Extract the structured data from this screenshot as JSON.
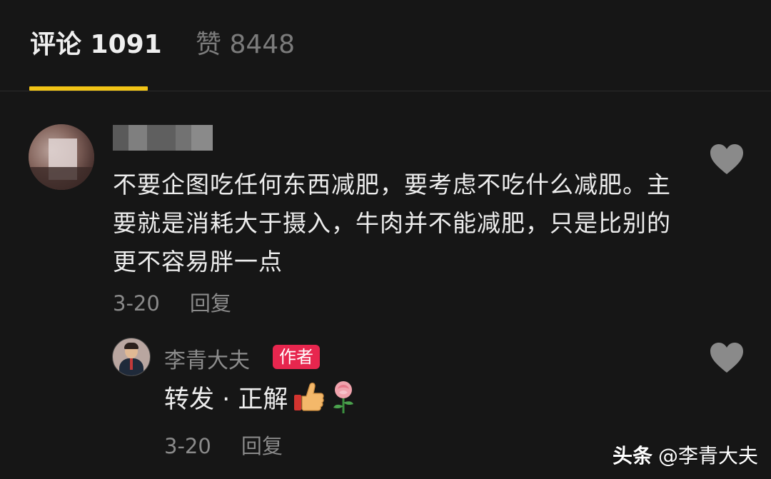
{
  "tabs": {
    "comments": "评论 1091",
    "likes": "赞 8448"
  },
  "comments": [
    {
      "text": "不要企图吃任何东西减肥，要考虑不吃什么减肥。主要就是消耗大于摄入，牛肉并不能减肥，只是比别的更不容易胖一点",
      "date": "3-20",
      "reply_label": "回复",
      "replies": [
        {
          "author": "李青大夫",
          "badge": "作者",
          "text": "转发 · 正解",
          "emojis": [
            "thumbs-up",
            "rose"
          ],
          "date": "3-20",
          "reply_label": "回复"
        }
      ]
    }
  ],
  "watermark": {
    "brand": "头条",
    "handle": "@李青大夫"
  },
  "colors": {
    "background": "#161616",
    "tab_indicator": "#f2c416",
    "author_badge": "#e7264e",
    "heart": "#8a8a8a"
  }
}
